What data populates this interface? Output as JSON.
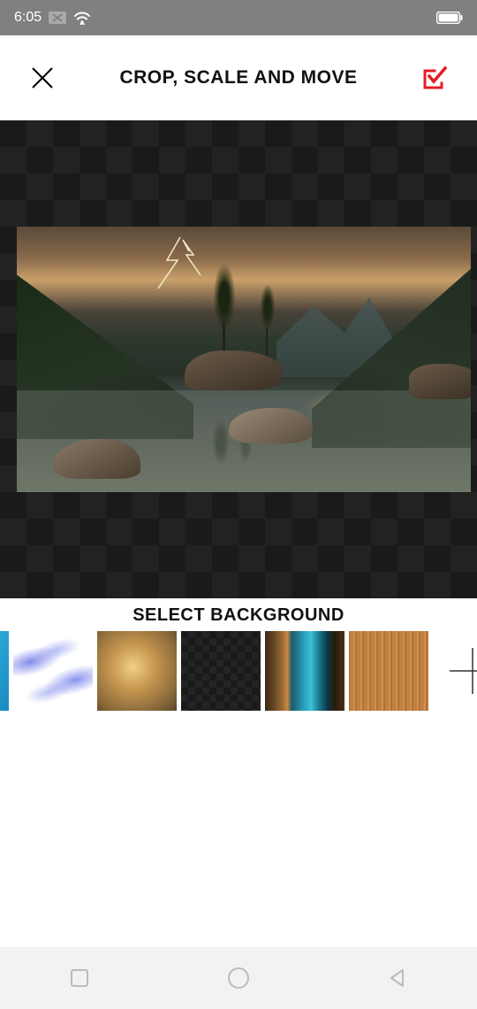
{
  "status": {
    "time": "6:05"
  },
  "header": {
    "title": "CROP, SCALE AND MOVE"
  },
  "backgrounds": {
    "label": "SELECT BACKGROUND"
  }
}
